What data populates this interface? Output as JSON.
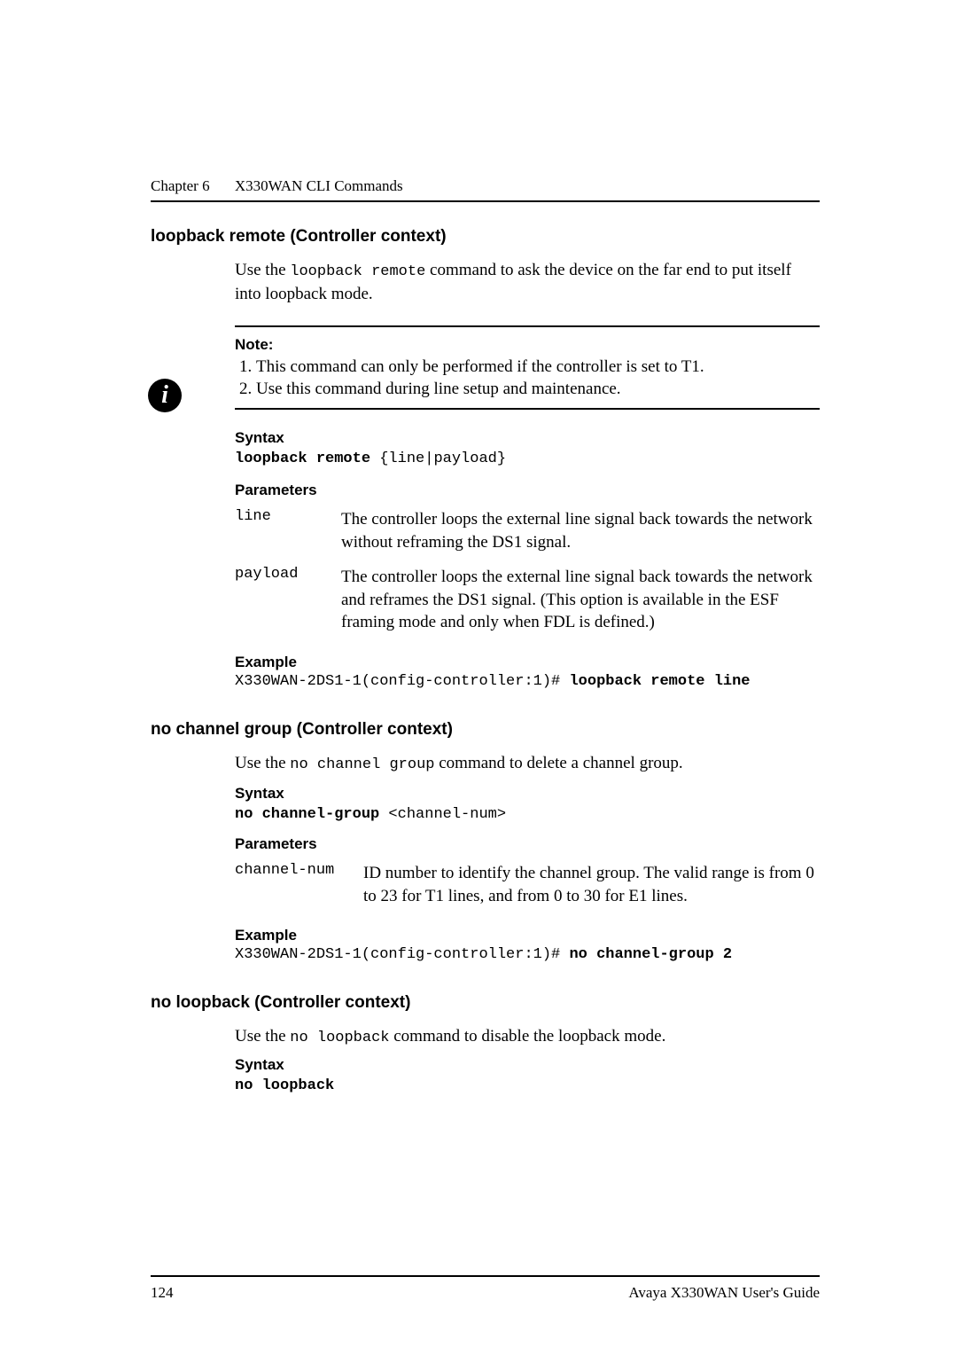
{
  "header": {
    "chapter": "Chapter 6",
    "title": "X330WAN CLI Commands"
  },
  "sections": [
    {
      "heading": "loopback remote (Controller context)",
      "intro_prefix": "Use the ",
      "intro_code": "loopback remote",
      "intro_suffix": " command to ask the device on the far end to put itself into loopback mode.",
      "note": {
        "label": "Note:",
        "items": [
          "This command can only be performed if the controller is set to T1.",
          "Use this command during line setup and maintenance."
        ]
      },
      "syntax_label": "Syntax",
      "syntax_bold": "loopback remote",
      "syntax_rest": " {line|payload}",
      "params_label": "Parameters",
      "params": [
        {
          "key": "line",
          "desc": "The controller loops the external line signal back towards the network without reframing the DS1 signal."
        },
        {
          "key": "payload",
          "desc": "The controller loops the external line signal back towards the network and reframes the DS1 signal. (This option is available in the ESF framing mode and only when FDL is defined.)"
        }
      ],
      "example_label": "Example",
      "example_prefix": "X330WAN-2DS1-1(config-controller:1)# ",
      "example_bold": "loopback remote line"
    },
    {
      "heading": "no channel group (Controller context)",
      "intro_prefix": "Use the ",
      "intro_code": "no channel group",
      "intro_suffix": " command to delete a channel group.",
      "syntax_label": "Syntax",
      "syntax_bold": "no channel-group",
      "syntax_rest": " <channel-num>",
      "params_label": "Parameters",
      "params": [
        {
          "key": "channel-num",
          "desc": "ID number to identify the channel group. The valid range is from 0 to 23 for T1 lines, and from 0 to 30 for E1 lines."
        }
      ],
      "example_label": "Example",
      "example_prefix": "X330WAN-2DS1-1(config-controller:1)# ",
      "example_bold": "no channel-group 2"
    },
    {
      "heading": "no loopback (Controller context)",
      "intro_prefix": "Use the ",
      "intro_code": "no loopback",
      "intro_suffix": " command to disable the loopback mode.",
      "syntax_label": "Syntax",
      "syntax_bold": "no loopback",
      "syntax_rest": ""
    }
  ],
  "footer": {
    "page": "124",
    "doc": "Avaya X330WAN User's Guide"
  },
  "icons": {
    "info": "i"
  }
}
